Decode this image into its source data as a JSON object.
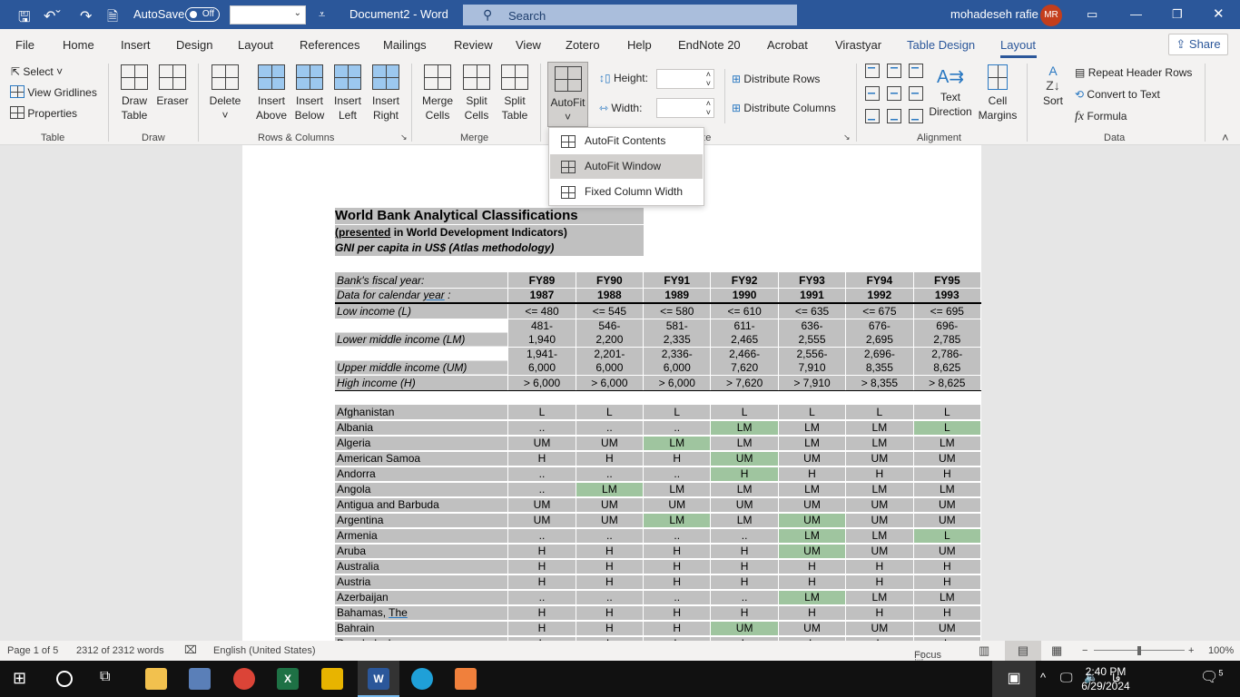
{
  "titlebar": {
    "autosave": "AutoSave",
    "autosave_state": "Off",
    "doc_title": "Document2  -  Word",
    "search": "Search",
    "user": "mohadeseh rafie",
    "initials": "MR"
  },
  "tabs": [
    "File",
    "Home",
    "Insert",
    "Design",
    "Layout",
    "References",
    "Mailings",
    "Review",
    "View",
    "Zotero",
    "Help",
    "EndNote 20",
    "Acrobat",
    "Virastyar",
    "Table Design",
    "Layout"
  ],
  "share": "Share",
  "ribbon": {
    "table_group": {
      "select": "Select",
      "view_gridlines": "View Gridlines",
      "properties": "Properties",
      "label": "Table"
    },
    "draw_group": {
      "draw_table": "Draw Table",
      "eraser": "Eraser",
      "label": "Draw"
    },
    "rows_cols": {
      "delete": "Delete",
      "insert_above": "Insert Above",
      "insert_below": "Insert Below",
      "insert_left": "Insert Left",
      "insert_right": "Insert Right",
      "label": "Rows & Columns"
    },
    "merge": {
      "merge_cells": "Merge Cells",
      "split_cells": "Split Cells",
      "split_table": "Split Table",
      "label": "Merge"
    },
    "cell_size": {
      "autofit": "AutoFit",
      "height": "Height:",
      "width": "Width:",
      "distribute_rows": "Distribute Rows",
      "distribute_columns": "Distribute Columns",
      "label": "Cell Size"
    },
    "alignment": {
      "text_direction": "Text Direction",
      "cell_margins": "Cell Margins",
      "label": "Alignment"
    },
    "data": {
      "sort": "Sort",
      "repeat_header_rows": "Repeat Header Rows",
      "convert_to_text": "Convert to Text",
      "formula": "Formula",
      "label": "Data"
    }
  },
  "autofit_menu": [
    {
      "label": "AutoFit Contents",
      "highlighted": false
    },
    {
      "label": "AutoFit Window",
      "highlighted": true
    },
    {
      "label": "Fixed Column Width",
      "highlighted": false
    }
  ],
  "document": {
    "title": "World Bank Analytical Classifications",
    "subtitle_pre": "(presented",
    "subtitle_post": " in World Development Indicators)",
    "subtitle2": "GNI per capita in US$ (Atlas methodology)",
    "fiscal_label": "Bank's fiscal year:",
    "calendar_label": "Data for calendar year :",
    "fiscal_years": [
      "FY89",
      "FY90",
      "FY91",
      "FY92",
      "FY93",
      "FY94",
      "FY95"
    ],
    "calendar_years": [
      "1987",
      "1988",
      "1989",
      "1990",
      "1991",
      "1992",
      "1993"
    ],
    "income": [
      {
        "label": "Low income (L)",
        "values": [
          "<= 480",
          "<= 545",
          "<= 580",
          "<= 610",
          "<= 635",
          "<= 675",
          "<= 695"
        ]
      },
      {
        "label": "Lower middle income (LM)",
        "values": [
          "481-\n1,940",
          "546-\n2,200",
          "581-\n2,335",
          "611-\n2,465",
          "636-\n2,555",
          "676-\n2,695",
          "696-\n2,785"
        ]
      },
      {
        "label": "Upper middle income (UM)",
        "values": [
          "1,941-\n6,000",
          "2,201-\n6,000",
          "2,336-\n6,000",
          "2,466-\n7,620",
          "2,556-\n7,910",
          "2,696-\n8,355",
          "2,786-\n8,625"
        ]
      },
      {
        "label": "High income (H)",
        "values": [
          "> 6,000",
          "> 6,000",
          "> 6,000",
          "> 7,620",
          "> 7,910",
          "> 8,355",
          "> 8,625"
        ]
      }
    ],
    "highlight_color": "#9fc59f",
    "countries": [
      {
        "name": "Afghanistan",
        "values": [
          "L",
          "L",
          "L",
          "L",
          "L",
          "L",
          "L"
        ],
        "changed": []
      },
      {
        "name": "Albania",
        "values": [
          "..",
          "..",
          "..",
          "LM",
          "LM",
          "LM",
          "L"
        ],
        "changed": [
          3,
          6
        ]
      },
      {
        "name": "Algeria",
        "values": [
          "UM",
          "UM",
          "LM",
          "LM",
          "LM",
          "LM",
          "LM"
        ],
        "changed": [
          2
        ]
      },
      {
        "name": "American Samoa",
        "values": [
          "H",
          "H",
          "H",
          "UM",
          "UM",
          "UM",
          "UM"
        ],
        "changed": [
          3
        ]
      },
      {
        "name": "Andorra",
        "values": [
          "..",
          "..",
          "..",
          "H",
          "H",
          "H",
          "H"
        ],
        "changed": [
          3
        ]
      },
      {
        "name": "Angola",
        "values": [
          "..",
          "LM",
          "LM",
          "LM",
          "LM",
          "LM",
          "LM"
        ],
        "changed": [
          1
        ]
      },
      {
        "name": "Antigua and Barbuda",
        "values": [
          "UM",
          "UM",
          "UM",
          "UM",
          "UM",
          "UM",
          "UM"
        ],
        "changed": []
      },
      {
        "name": "Argentina",
        "values": [
          "UM",
          "UM",
          "LM",
          "LM",
          "UM",
          "UM",
          "UM"
        ],
        "changed": [
          2,
          4
        ]
      },
      {
        "name": "Armenia",
        "values": [
          "..",
          "..",
          "..",
          "..",
          "LM",
          "LM",
          "L"
        ],
        "changed": [
          4,
          6
        ]
      },
      {
        "name": "Aruba",
        "values": [
          "H",
          "H",
          "H",
          "H",
          "UM",
          "UM",
          "UM"
        ],
        "changed": [
          4
        ]
      },
      {
        "name": "Australia",
        "values": [
          "H",
          "H",
          "H",
          "H",
          "H",
          "H",
          "H"
        ],
        "changed": []
      },
      {
        "name": "Austria",
        "values": [
          "H",
          "H",
          "H",
          "H",
          "H",
          "H",
          "H"
        ],
        "changed": []
      },
      {
        "name": "Azerbaijan",
        "values": [
          "..",
          "..",
          "..",
          "..",
          "LM",
          "LM",
          "LM"
        ],
        "changed": [
          4
        ]
      },
      {
        "name": "Bahamas, The",
        "values": [
          "H",
          "H",
          "H",
          "H",
          "H",
          "H",
          "H"
        ],
        "changed": []
      },
      {
        "name": "Bahrain",
        "values": [
          "H",
          "H",
          "H",
          "UM",
          "UM",
          "UM",
          "UM"
        ],
        "changed": [
          3
        ]
      },
      {
        "name": "Bangladesh",
        "values": [
          "L",
          "L",
          "L",
          "L",
          "L",
          "L",
          "L"
        ],
        "changed": []
      }
    ]
  },
  "status": {
    "page": "Page 1 of 5",
    "words": "2312 of 2312 words",
    "language": "English (United States)",
    "focus": "Focus",
    "zoom": "100%",
    "zoom_value": 100
  },
  "taskbar": {
    "time": "2:40 PM",
    "date": "6/29/2024",
    "lang": "فا",
    "notifications": "5"
  }
}
